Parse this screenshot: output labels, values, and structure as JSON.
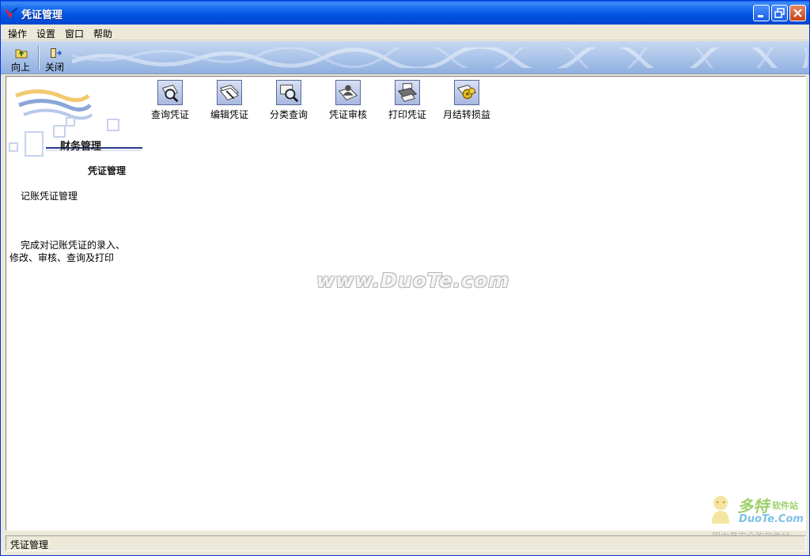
{
  "window": {
    "title": "凭证管理"
  },
  "menu": [
    {
      "label": "操作"
    },
    {
      "label": "设置"
    },
    {
      "label": "窗口"
    },
    {
      "label": "帮助"
    }
  ],
  "toolbar": {
    "up_label": "向上",
    "close_label": "关闭"
  },
  "sidebar": {
    "logo_title": "财务管理",
    "logo_subtitle": "凭证管理",
    "section_title": "记账凭证管理",
    "description_line1": "完成对记账凭证的录入、",
    "description_line2": "修改、审核、查询及打印"
  },
  "functions": [
    {
      "label": "查询凭证",
      "icon": "search-voucher-icon"
    },
    {
      "label": "编辑凭证",
      "icon": "edit-voucher-icon"
    },
    {
      "label": "分类查询",
      "icon": "category-search-icon"
    },
    {
      "label": "凭证审核",
      "icon": "audit-voucher-icon"
    },
    {
      "label": "打印凭证",
      "icon": "print-voucher-icon"
    },
    {
      "label": "月结转损益",
      "icon": "month-end-icon"
    }
  ],
  "watermark": "www.DuoTe.com",
  "corner_logo": {
    "name": "多特",
    "tag": "软件站",
    "site": "DuoTe.Com",
    "slogan": "国内最安全的软件站"
  },
  "status": {
    "text": "凭证管理"
  },
  "colors": {
    "titlebar": "#0054e3",
    "chrome": "#ece9d8",
    "toolbar": "#aec6ea",
    "close": "#c6401a"
  }
}
